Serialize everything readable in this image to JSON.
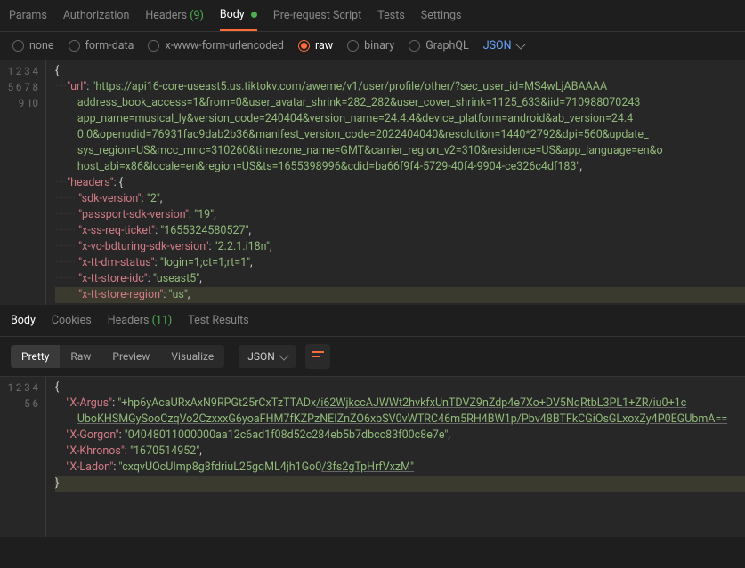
{
  "reqTabs": {
    "params": "Params",
    "authorization": "Authorization",
    "headers": "Headers",
    "headersCount": "(9)",
    "body": "Body",
    "prerequest": "Pre-request Script",
    "tests": "Tests",
    "settings": "Settings"
  },
  "bodyTypes": {
    "none": "none",
    "formdata": "form-data",
    "xwww": "x-www-form-urlencoded",
    "raw": "raw",
    "binary": "binary",
    "graphql": "GraphQL",
    "json": "JSON"
  },
  "reqJson": {
    "urlKey": "\"url\"",
    "urlLine1": "\"https://api16-core-useast5.us.tiktokv.com/aweme/v1/user/profile/other/?sec_user_id=MS4wLjABAAAA",
    "urlLine2": "address_book_access=1&from=0&user_avatar_shrink=282_282&user_cover_shrink=1125_633&iid=710988070243",
    "urlLine3": "app_name=musical_ly&version_code=240404&version_name=24.4.4&device_platform=android&ab_version=24.4",
    "urlLine4": "0.0&openudid=76931fac9dab2b36&manifest_version_code=2022404040&resolution=1440*2792&dpi=560&update_",
    "urlLine5": "sys_region=US&mcc_mnc=310260&timezone_name=GMT&carrier_region_v2=310&residence=US&app_language=en&o",
    "urlLine6": "host_abi=x86&locale=en&region=US&ts=1655398996&cdid=ba66f9f4-5729-40f4-9904-ce326c4df183\"",
    "headersKey": "\"headers\"",
    "sdkVersionKey": "\"sdk-version\"",
    "sdkVersionVal": "\"2\"",
    "passportKey": "\"passport-sdk-version\"",
    "passportVal": "\"19\"",
    "xssKey": "\"x-ss-req-ticket\"",
    "xssVal": "\"1655324580527\"",
    "xvcKey": "\"x-vc-bdturing-sdk-version\"",
    "xvcVal": "\"2.2.1.i18n\"",
    "xttdmKey": "\"x-tt-dm-status\"",
    "xttdmVal": "\"login=1;ct=1;rt=1\"",
    "xttstoreKey": "\"x-tt-store-idc\"",
    "xttstoreVal": "\"useast5\"",
    "xttregKey": "\"x-tt-store-region\"",
    "xttregVal": "\"us\""
  },
  "respTabs": {
    "body": "Body",
    "cookies": "Cookies",
    "headers": "Headers",
    "headersCount": "(11)",
    "testResults": "Test Results"
  },
  "viewTabs": {
    "pretty": "Pretty",
    "raw": "Raw",
    "preview": "Preview",
    "visualize": "Visualize",
    "json": "JSON"
  },
  "respJson": {
    "xArgusKey": "\"X-Argus\"",
    "xArgusVal1": "\"+hp6yAcaURxAxN9RPGt25rCxTzTTADx",
    "xArgusVal1b": "/i62WjkccAJWWt2hvkfxUnTDVZ9nZdp4e7Xo+DV5NqRtbL3PL1+ZR/iu0+1c",
    "xArgusVal2": "UboKHSMGySooCzqVo2CzxxxG6yoaFHM7fKZPzNEIZnZO6xbSV0vWTRC46m5RH4BW1p/Pbv48BTFkCGiOsGLxoxZy4P0EGUbmA==",
    "xGorgonKey": "\"X-Gorgon\"",
    "xGorgonVal": "\"04048011000000aa12c6ad1f08d52c284eb5b7dbcc83f00c8e7e\"",
    "xKhronosKey": "\"X-Khronos\"",
    "xKhronosVal": "\"1670514952\"",
    "xLadonKey": "\"X-Ladon\"",
    "xLadonVal1": "\"cxqvUOcUImp8g8fdriuL25gqML4jh1Go0",
    "xLadonVal2": "/3fs2gTpHrfVxzM\""
  }
}
